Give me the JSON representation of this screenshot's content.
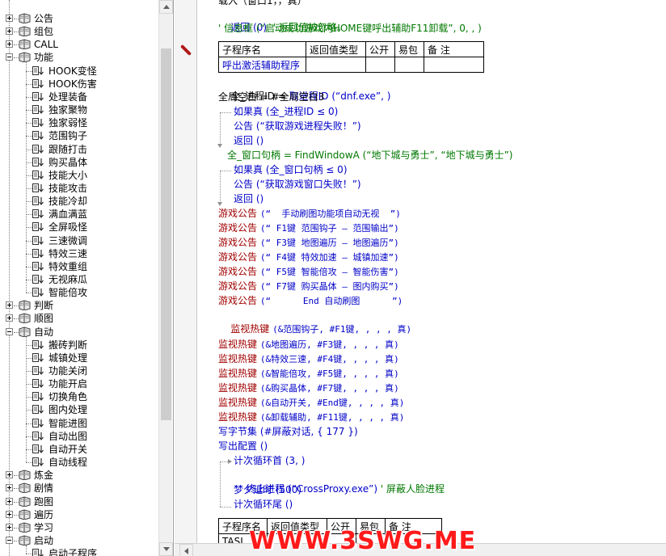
{
  "tree": {
    "items": [
      {
        "label": "公告",
        "type": "folder",
        "expanded": false
      },
      {
        "label": "组包",
        "type": "folder",
        "expanded": false
      },
      {
        "label": "CALL",
        "type": "folder",
        "expanded": false
      },
      {
        "label": "功能",
        "type": "folder",
        "expanded": true
      },
      {
        "label": "HOOK变怪",
        "type": "page"
      },
      {
        "label": "HOOK伤害",
        "type": "page"
      },
      {
        "label": "处理装备",
        "type": "page"
      },
      {
        "label": "独家聚物",
        "type": "page"
      },
      {
        "label": "独家弱怪",
        "type": "page"
      },
      {
        "label": "范围钩子",
        "type": "page"
      },
      {
        "label": "跟随打击",
        "type": "page"
      },
      {
        "label": "购买晶体",
        "type": "page"
      },
      {
        "label": "技能大小",
        "type": "page"
      },
      {
        "label": "技能攻击",
        "type": "page"
      },
      {
        "label": "技能冷却",
        "type": "page"
      },
      {
        "label": "满血满蓝",
        "type": "page"
      },
      {
        "label": "全屏吸怪",
        "type": "page"
      },
      {
        "label": "三速微调",
        "type": "page"
      },
      {
        "label": "特效三速",
        "type": "page"
      },
      {
        "label": "特效重组",
        "type": "page"
      },
      {
        "label": "无视麻瓜",
        "type": "page"
      },
      {
        "label": "智能倍攻",
        "type": "page"
      },
      {
        "label": "判断",
        "type": "folder",
        "expanded": false
      },
      {
        "label": "顺图",
        "type": "folder",
        "expanded": false
      },
      {
        "label": "自动",
        "type": "folder",
        "expanded": true
      },
      {
        "label": "搬砖判断",
        "type": "page"
      },
      {
        "label": "城镇处理",
        "type": "page"
      },
      {
        "label": "功能关闭",
        "type": "page"
      },
      {
        "label": "功能开启",
        "type": "page"
      },
      {
        "label": "切换角色",
        "type": "page"
      },
      {
        "label": "图内处理",
        "type": "page"
      },
      {
        "label": "智能进图",
        "type": "page"
      },
      {
        "label": "自动出图",
        "type": "page"
      },
      {
        "label": "自动开关",
        "type": "page"
      },
      {
        "label": "自动线程",
        "type": "page"
      },
      {
        "label": "炼金",
        "type": "folder",
        "expanded": false
      },
      {
        "label": "剧情",
        "type": "folder",
        "expanded": false
      },
      {
        "label": "跑图",
        "type": "folder",
        "expanded": false
      },
      {
        "label": "遍历",
        "type": "folder",
        "expanded": false
      },
      {
        "label": "学习",
        "type": "folder",
        "expanded": false
      },
      {
        "label": "启动",
        "type": "folder",
        "expanded": true
      },
      {
        "label": "启动子程序",
        "type": "page"
      }
    ]
  },
  "code": {
    "line0": "载入（窗口1，，真）",
    "line_return": "返回 (0)",
    "line_return_comment": "' 返回值被忽略。",
    "line_msgbox": "' 信息框 (“启动成功游戏内HOME键呼出辅助F11卸载”, 0, , )",
    "table1": {
      "headers": [
        "子程序名",
        "返回值类型",
        "公开",
        "易包",
        "备 注"
      ],
      "row": [
        "呼出激活辅助程序",
        "",
        "",
        "",
        ""
      ]
    },
    "assign1_lhs": "全_进程ID =",
    "assign1_rhs": "取进程ID (“dnf.exe”, )",
    "assign2": "全局空白 = #全局空白3",
    "if1": "如果真 (全_进程ID ≤ 0)",
    "if1_notice": "公告 (“获取游戏进程失败！”)",
    "if1_return": "返回 ()",
    "assign3": "全_窗口句柄 = FindWindowA (“地下城与勇士”, “地下城与勇士”)",
    "if2": "如果真 (全_窗口句柄 ≤ 0)",
    "if2_notice": "公告 (“获取游戏窗口失败！”)",
    "if2_return": "返回 ()",
    "notices": [
      {
        "fn": "游戏公告",
        "arg": "(“  手动刷图功能项自动无视  ”)"
      },
      {
        "fn": "游戏公告",
        "arg": "(“ F1键 范围钩子 — 范围输出”)"
      },
      {
        "fn": "游戏公告",
        "arg": "(“ F3键 地图遍历 — 地图遍历”)"
      },
      {
        "fn": "游戏公告",
        "arg": "(“ F4键 特效加速 — 城镇加速”)"
      },
      {
        "fn": "游戏公告",
        "arg": "(“ F5键 智能倍攻 — 智能伤害”)"
      },
      {
        "fn": "游戏公告",
        "arg": "(“ F7键 购买晶体 — 图内购买”)"
      },
      {
        "fn": "游戏公告",
        "arg": "(“      End 自动刷图      ”)"
      }
    ],
    "hotkey_first": {
      "fn": "监视热键",
      "arg": "(&范围钩子, #F1键, , , , 真)"
    },
    "hotkeys": [
      {
        "fn": "监视热键",
        "arg": "(&地图遍历, #F3键, , , , 真)"
      },
      {
        "fn": "监视热键",
        "arg": "(&特效三速, #F4键, , , , 真)"
      },
      {
        "fn": "监视热键",
        "arg": "(&智能倍攻, #F5键, , , , 真)"
      },
      {
        "fn": "监视热键",
        "arg": "(&购买晶体, #F7键, , , , 真)"
      },
      {
        "fn": "监视热键",
        "arg": "(&自动开关, #End键, , , , 真)"
      },
      {
        "fn": "监视热键",
        "arg": "(&卸载辅助, #F11键, , , , 真)"
      }
    ],
    "write_bytes": "写字节集 (#屏蔽对话, { 177 })",
    "write_config": "写出配置 ()",
    "loop_start": "计次循环首 (3, )",
    "loop_kill": "终止进程 (“CrossProxy.exe”)",
    "loop_kill_comment": "' 屏蔽人脸进程",
    "loop_sleep": "梦夕延时 (500)",
    "loop_end": "计次循环尾 ()",
    "table2": {
      "headers": [
        "子程序名",
        "返回值类型",
        "公开",
        "易包",
        "备 注"
      ],
      "row": [
        "TASI",
        "",
        "",
        "",
        ""
      ]
    }
  },
  "watermark": "WWW.3SWG.ME",
  "colors": {
    "keyword_blue": "#0000c8",
    "comment_green": "#007800",
    "function_red": "#a00000",
    "watermark_red": "#ff1a1a"
  }
}
